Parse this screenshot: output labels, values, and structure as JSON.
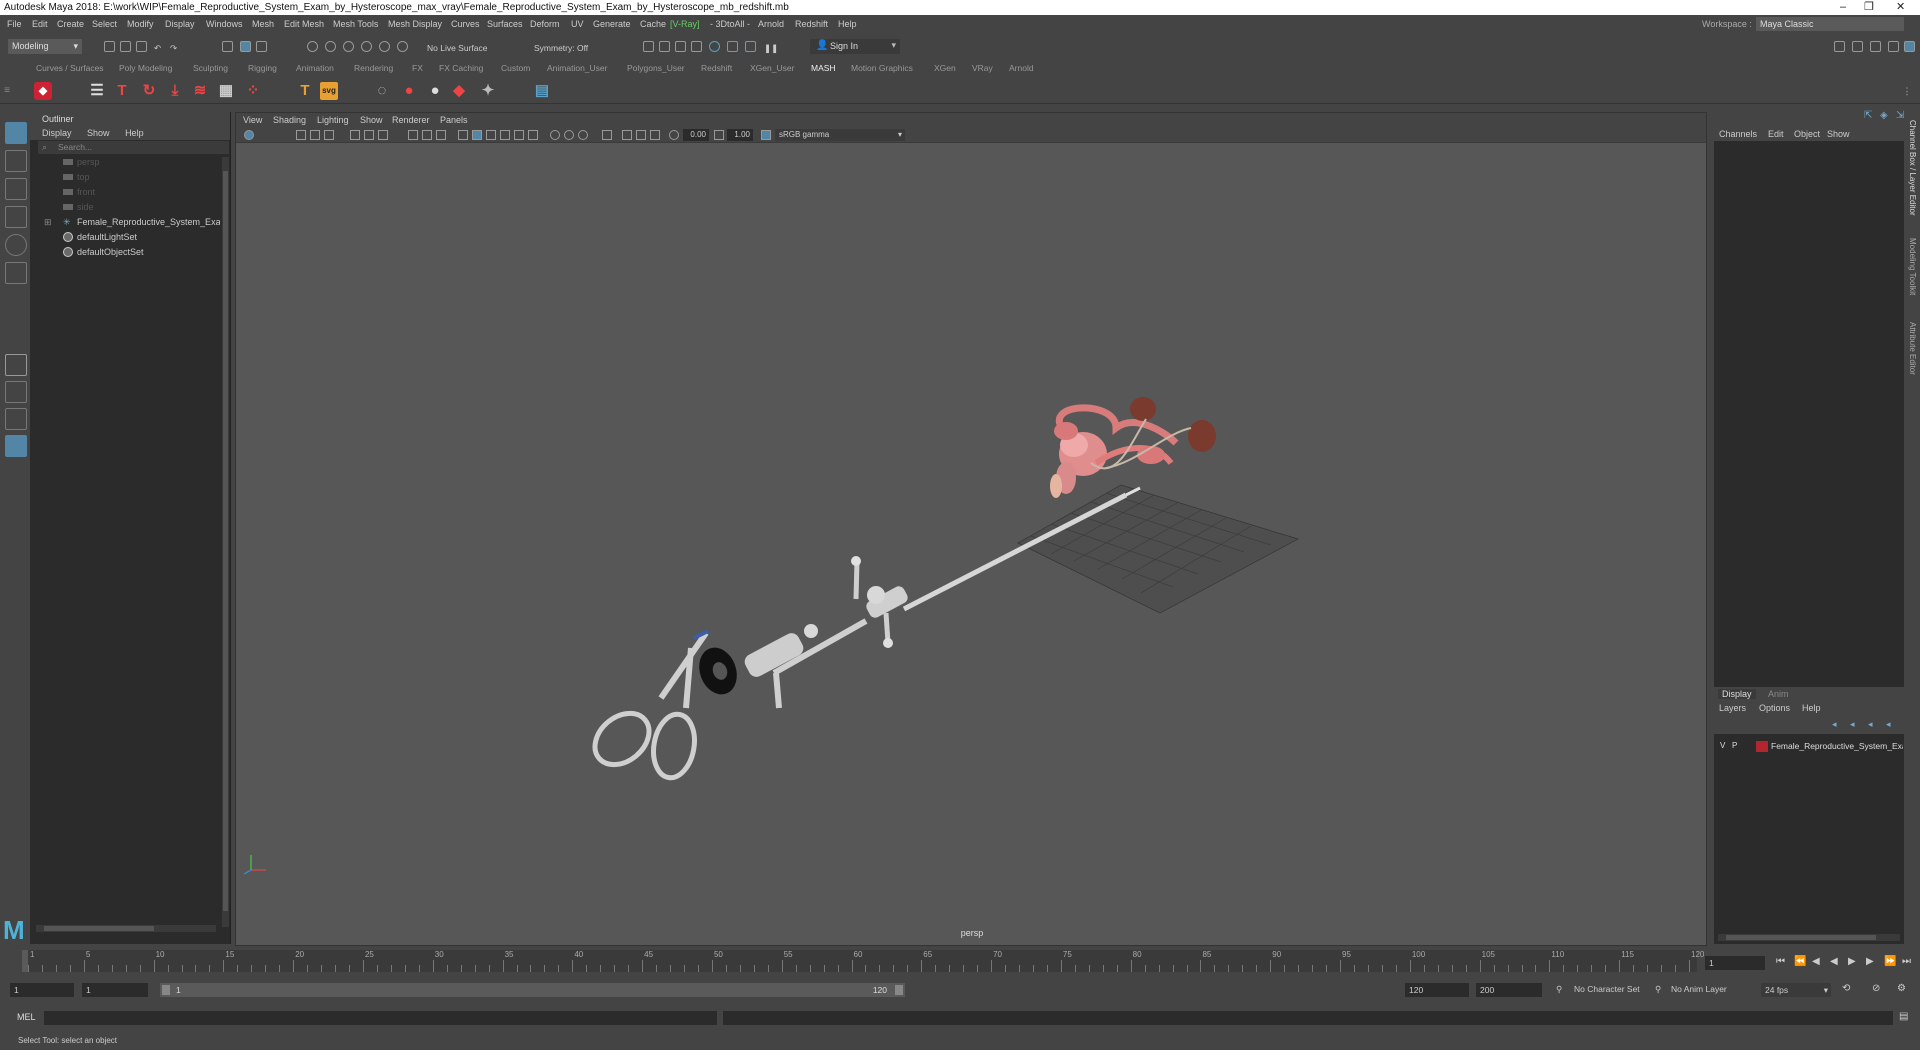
{
  "window": {
    "title": "Autodesk Maya 2018: E:\\work\\WIP\\Female_Reproductive_System_Exam_by_Hysteroscope_max_vray\\Female_Reproductive_System_Exam_by_Hysteroscope_mb_redshift.mb"
  },
  "menubar": {
    "items": [
      "File",
      "Edit",
      "Create",
      "Select",
      "Modify",
      "Display",
      "Windows",
      "Mesh",
      "Edit Mesh",
      "Mesh Tools",
      "Mesh Display",
      "Curves",
      "Surfaces",
      "Deform",
      "UV",
      "Generate",
      "Cache",
      "[V-Ray]",
      "- 3DtoAll -",
      "Arnold",
      "Redshift",
      "Help"
    ],
    "workspace_label": "Workspace :",
    "workspace_value": "Maya Classic"
  },
  "statusline": {
    "mode": "Modeling",
    "live_surface": "No Live Surface",
    "symmetry": "Symmetry: Off",
    "sign_in": "Sign In"
  },
  "shelf": {
    "tabs": [
      "Curves / Surfaces",
      "Poly Modeling",
      "Sculpting",
      "Rigging",
      "Animation",
      "Rendering",
      "FX",
      "FX Caching",
      "Custom",
      "Animation_User",
      "Polygons_User",
      "Redshift",
      "XGen_User",
      "MASH",
      "Motion Graphics",
      "XGen",
      "VRay",
      "Arnold"
    ],
    "active_tab": "MASH"
  },
  "outliner": {
    "title": "Outliner",
    "menu": [
      "Display",
      "Show",
      "Help"
    ],
    "search_placeholder": "Search...",
    "items": [
      {
        "label": "persp",
        "type": "camera",
        "dim": true
      },
      {
        "label": "top",
        "type": "camera",
        "dim": true
      },
      {
        "label": "front",
        "type": "camera",
        "dim": true
      },
      {
        "label": "side",
        "type": "camera",
        "dim": true
      },
      {
        "label": "Female_Reproductive_System_Exam_b",
        "type": "group",
        "dim": false
      },
      {
        "label": "defaultLightSet",
        "type": "set",
        "dim": false
      },
      {
        "label": "defaultObjectSet",
        "type": "set",
        "dim": false
      }
    ]
  },
  "viewport": {
    "menu": [
      "View",
      "Shading",
      "Lighting",
      "Show",
      "Renderer",
      "Panels"
    ],
    "exposure": "0.00",
    "gamma": "1.00",
    "colorspace": "sRGB gamma",
    "camera_label": "persp"
  },
  "channelbox": {
    "menu": [
      "Channels",
      "Edit",
      "Object",
      "Show"
    ],
    "side_tabs": [
      "Channel Box / Layer Editor",
      "Modeling Toolkit",
      "Attribute Editor"
    ]
  },
  "layer_editor": {
    "tabs": [
      "Display",
      "Anim"
    ],
    "menu": [
      "Layers",
      "Options",
      "Help"
    ],
    "layer": {
      "v": "V",
      "p": "P",
      "name": "Female_Reproductive_System_Exa",
      "color": "#b4262f"
    }
  },
  "timeline": {
    "ticks": [
      "1",
      "5",
      "10",
      "15",
      "20",
      "25",
      "30",
      "35",
      "40",
      "45",
      "50",
      "55",
      "60",
      "65",
      "70",
      "75",
      "80",
      "85",
      "90",
      "95",
      "100",
      "105",
      "110",
      "115",
      "120"
    ],
    "current_frame": "1"
  },
  "range": {
    "start": "1",
    "start_inner": "1",
    "slider_start": "1",
    "slider_end": "120",
    "end_inner": "120",
    "end": "200",
    "character_set": "No Character Set",
    "anim_layer": "No Anim Layer",
    "fps": "24 fps"
  },
  "commandline": {
    "label": "MEL"
  },
  "helpline": {
    "text": "Select Tool: select an object"
  },
  "colors": {
    "accent": "#5285a6",
    "layer_color": "#b4262f",
    "vray_green": "#66cc66"
  }
}
